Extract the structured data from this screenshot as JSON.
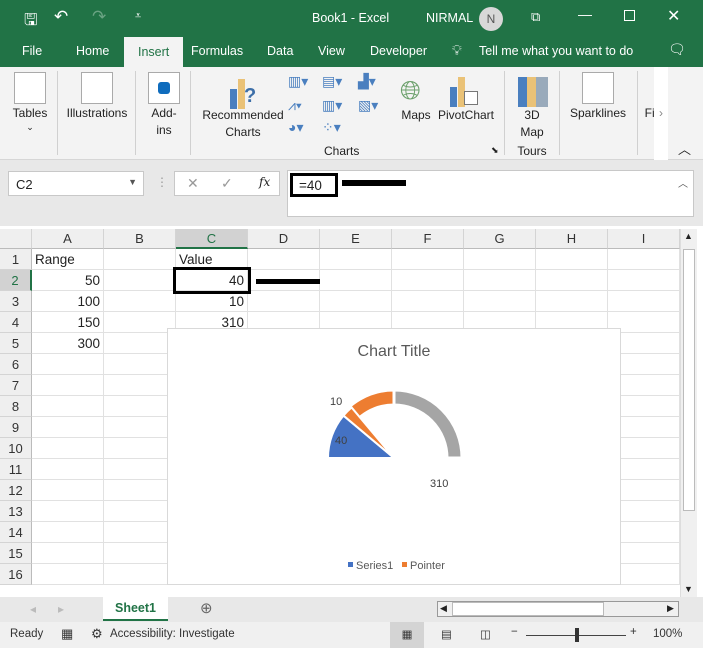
{
  "titlebar": {
    "title": "Book1  -  Excel",
    "user": "NIRMAL",
    "avatar": "N"
  },
  "tabs": [
    "File",
    "Home",
    "Insert",
    "Formulas",
    "Data",
    "View",
    "Developer"
  ],
  "tell_me": "Tell me what you want to do",
  "ribbon": {
    "tables": "Tables",
    "illustrations": "Illustrations",
    "addins_1": "Add-",
    "addins_2": "ins",
    "recommended_1": "Recommended",
    "recommended_2": "Charts",
    "maps": "Maps",
    "pivotchart": "PivotChart",
    "map3d_1": "3D",
    "map3d_2": "Map",
    "sparklines": "Sparklines",
    "filters": "Fil",
    "group_charts": "Charts",
    "group_tours": "Tours"
  },
  "formula_bar": {
    "name_box": "C2",
    "fx": "fx",
    "formula": "=40"
  },
  "columns": [
    "A",
    "B",
    "C",
    "D",
    "E",
    "F",
    "G",
    "H",
    "I"
  ],
  "rows": [
    "1",
    "2",
    "3",
    "4",
    "5",
    "6",
    "7",
    "8",
    "9",
    "10",
    "11",
    "12",
    "13",
    "14",
    "15",
    "16"
  ],
  "cells": {
    "A1": "Range",
    "A2": "50",
    "A3": "100",
    "A4": "150",
    "A5": "300",
    "C1": "Value",
    "C2": "40",
    "C3": "10",
    "C4": "310"
  },
  "chart_data": {
    "type": "doughnut-pie-gauge",
    "title": "Chart Title",
    "legend": [
      "Series1",
      "Pointer"
    ],
    "legend_position": "bottom",
    "ring": {
      "name": "Series1",
      "values": [
        50,
        100,
        150,
        300
      ],
      "colors": [
        "#4472c4",
        "#ed7d31",
        "#a5a5a5",
        "none"
      ]
    },
    "pie": {
      "name": "Pointer",
      "values": [
        40,
        10,
        310
      ],
      "labels": [
        "40",
        "10",
        "310"
      ],
      "colors": [
        "#4472c4",
        "#ed7d31",
        "none"
      ]
    }
  },
  "sheet_tab": "Sheet1",
  "status": {
    "ready": "Ready",
    "accessibility": "Accessibility: Investigate",
    "zoom": "100%"
  }
}
